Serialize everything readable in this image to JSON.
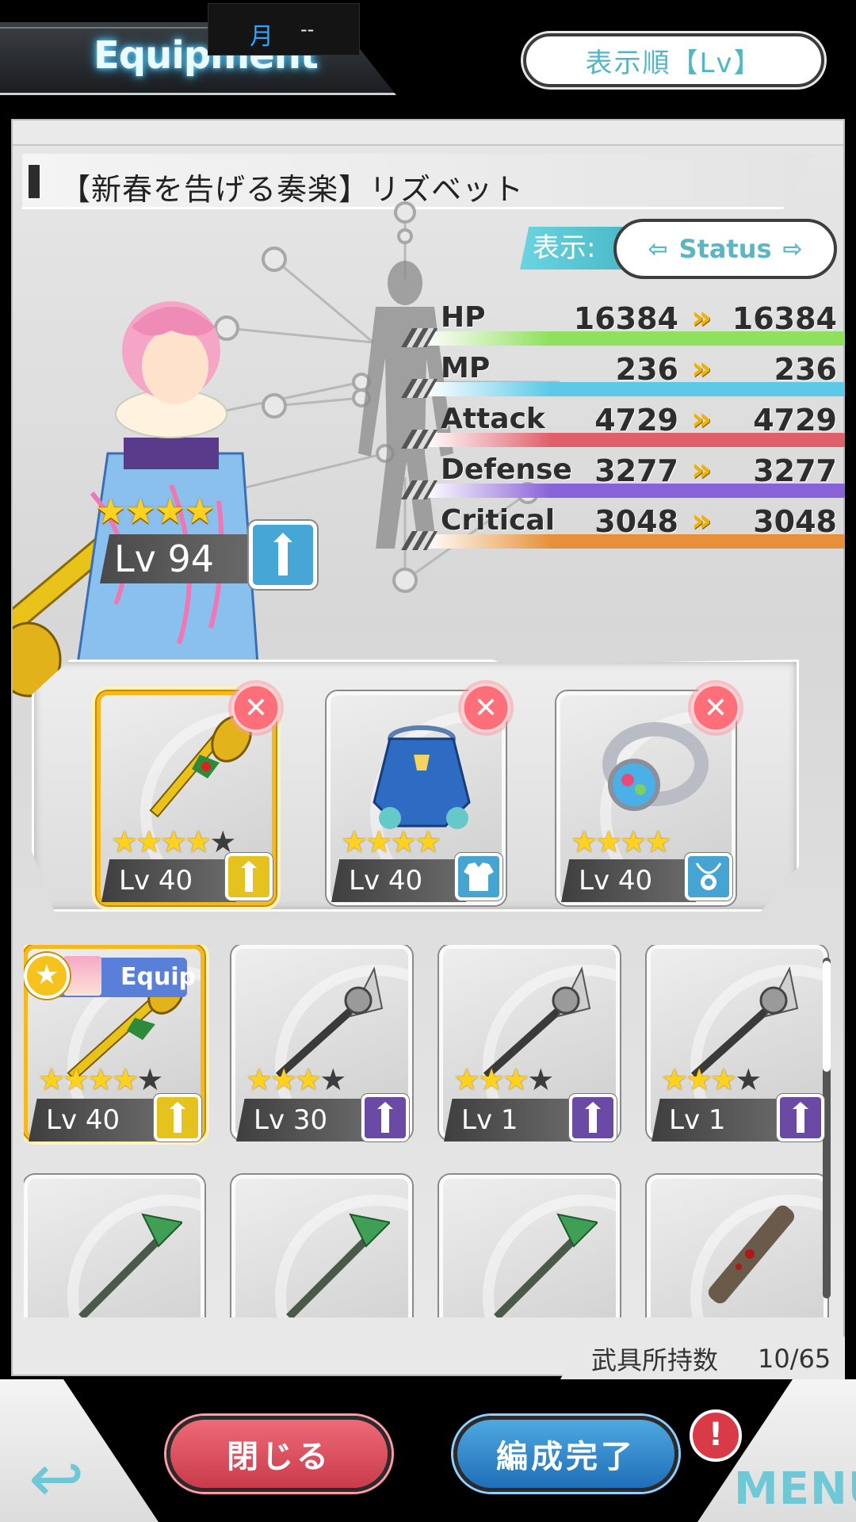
{
  "header": {
    "title": "Equipment",
    "date_month": "月",
    "date_value": "--",
    "sort_button": "表示順【Lv】"
  },
  "character": {
    "name": "【新春を告げる奏楽】リズベット",
    "stars": "★★★★",
    "level": "Lv 94",
    "weapon_type": "mace"
  },
  "display": {
    "label": "表示:",
    "toggle_label": "Status"
  },
  "stats": [
    {
      "label": "HP",
      "current": "16384",
      "new": "16384",
      "color": "#8fe05c"
    },
    {
      "label": "MP",
      "current": "236",
      "new": "236",
      "color": "#5cc9e8"
    },
    {
      "label": "Attack",
      "current": "4729",
      "new": "4729",
      "color": "#e0606a"
    },
    {
      "label": "Defense",
      "current": "3277",
      "new": "3277",
      "color": "#8a62d8"
    },
    {
      "label": "Critical",
      "current": "3048",
      "new": "3048",
      "color": "#e6913a"
    }
  ],
  "equipped": [
    {
      "name": "mace",
      "stars_on": "★★★★",
      "stars_off": "★",
      "level": "Lv 40",
      "type": "weapon",
      "type_color": "yellow"
    },
    {
      "name": "kimono-armor",
      "stars_on": "★★★★",
      "stars_off": "",
      "level": "Lv 40",
      "type": "armor",
      "type_color": "blue"
    },
    {
      "name": "ring",
      "stars_on": "★★★★",
      "stars_off": "",
      "level": "Lv 40",
      "type": "accessory",
      "type_color": "blue"
    }
  ],
  "inventory": {
    "equip_tag": "Equip",
    "items": [
      {
        "stars_on": "★★★★",
        "stars_off": "★",
        "level": "Lv 40",
        "type_color": "yellow",
        "equipped": true
      },
      {
        "stars_on": "★★★",
        "stars_off": "★",
        "level": "Lv 30",
        "type_color": "purple",
        "equipped": false
      },
      {
        "stars_on": "★★★",
        "stars_off": "★",
        "level": "Lv 1",
        "type_color": "purple",
        "equipped": false
      },
      {
        "stars_on": "★★★",
        "stars_off": "★",
        "level": "Lv 1",
        "type_color": "purple",
        "equipped": false
      },
      {
        "stars_on": "",
        "stars_off": "",
        "level": "",
        "type_color": "",
        "equipped": false
      },
      {
        "stars_on": "",
        "stars_off": "",
        "level": "",
        "type_color": "",
        "equipped": false
      },
      {
        "stars_on": "",
        "stars_off": "",
        "level": "",
        "type_color": "",
        "equipped": false
      },
      {
        "stars_on": "",
        "stars_off": "",
        "level": "",
        "type_color": "",
        "equipped": false
      }
    ],
    "count_label": "武具所持数",
    "count_value": "10/65"
  },
  "footer": {
    "close_button": "閉じる",
    "done_button": "編成完了",
    "alert_badge": "!",
    "menu_label": "MENU"
  }
}
